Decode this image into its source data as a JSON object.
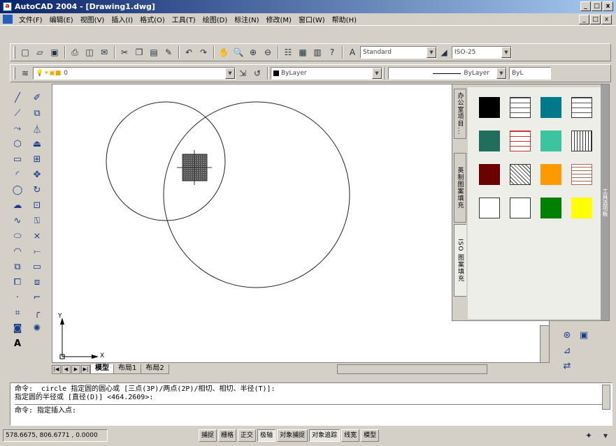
{
  "window": {
    "title": "AutoCAD 2004 - [Drawing1.dwg]",
    "min": "_",
    "max": "□",
    "close": "x"
  },
  "menu": [
    "文件(F)",
    "编辑(E)",
    "视图(V)",
    "插入(I)",
    "格式(O)",
    "工具(T)",
    "绘图(D)",
    "标注(N)",
    "修改(M)",
    "窗口(W)",
    "帮助(H)"
  ],
  "toolbar": {
    "text_style": "Standard",
    "dim_style": "ISO-25"
  },
  "properties": {
    "layer": "0",
    "color": "ByLayer",
    "linetype": "ByLayer",
    "lineweight": "ByL"
  },
  "tool_palette": {
    "tabs": [
      "办公室项目...",
      "英制图案填充",
      "ISO 图案填充"
    ],
    "side_label": "工具选项板",
    "swatches": [
      {
        "name": "black-swatch",
        "color": "#000000"
      },
      {
        "name": "brick-pattern",
        "color": "pattern"
      },
      {
        "name": "teal-swatch",
        "color": "#007a8a"
      },
      {
        "name": "brick-pattern-2",
        "color": "pattern"
      },
      {
        "name": "dark-green-swatch",
        "color": "#1f6f5c"
      },
      {
        "name": "red-brick-pattern",
        "color": "pattern"
      },
      {
        "name": "aqua-swatch",
        "color": "#3cc3a0"
      },
      {
        "name": "grid-pattern",
        "color": "pattern"
      },
      {
        "name": "maroon-swatch",
        "color": "#6b0000"
      },
      {
        "name": "hatch-pattern",
        "color": "pattern"
      },
      {
        "name": "orange-swatch",
        "color": "#ff9900"
      },
      {
        "name": "parquet-pattern",
        "color": "pattern"
      },
      {
        "name": "sketch-pattern",
        "color": "pattern"
      },
      {
        "name": "wave-pattern",
        "color": "pattern"
      },
      {
        "name": "green-swatch",
        "color": "#008000"
      },
      {
        "name": "yellow-swatch",
        "color": "#ffff00"
      }
    ]
  },
  "layout_tabs": [
    "模型",
    "布局1",
    "布局2"
  ],
  "ucs": {
    "x": "X",
    "y": "Y"
  },
  "command": {
    "line1": "命令: _circle 指定圆的圆心或 [三点(3P)/两点(2P)/相切、相切、半径(T)]:",
    "line2": "指定圆的半径或 [直径(D)] <464.2609>:",
    "prompt": "命令: 指定插入点:"
  },
  "status": {
    "coords": "578.6675, 806.6771 , 0.0000",
    "buttons": [
      "捕捉",
      "栅格",
      "正交",
      "极轴",
      "对象捕捉",
      "对象追踪",
      "线宽",
      "模型"
    ],
    "on": [
      false,
      false,
      false,
      true,
      false,
      true,
      false,
      false
    ]
  }
}
